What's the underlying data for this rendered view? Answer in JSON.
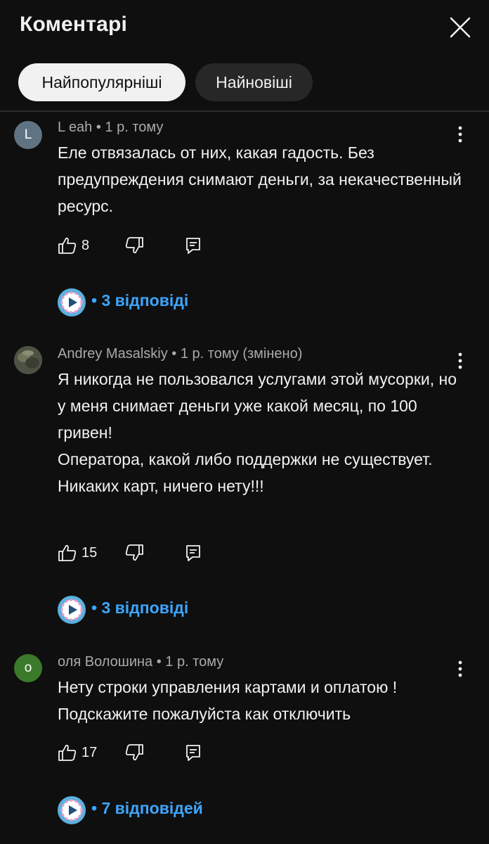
{
  "header": {
    "title": "Коментарі",
    "close_icon": "close-icon"
  },
  "sort_chips": [
    {
      "label": "Найпопулярніші",
      "selected": true
    },
    {
      "label": "Найновіші",
      "selected": false
    }
  ],
  "colors": {
    "background": "#0f0f0f",
    "accent_link": "#3ea6ff",
    "chip_active_bg": "#f1f1f1",
    "chip_inactive_bg": "#272727"
  },
  "comments": [
    {
      "avatar_letter": "L",
      "avatar_color": "#5f7382",
      "author": "L eah",
      "time": "• 1 р. тому",
      "text": "Еле отвязалась от них, какая гадость. Без предупреждения снимают деньги, за некачественный ресурс.",
      "likes": "8",
      "replies": "• 3 відповіді"
    },
    {
      "avatar_letter": "",
      "avatar_color": "#5a5f4a",
      "author": "Andrey Masalskiy",
      "time": "• 1 р. тому (змінено)",
      "text": "Я никогда не пользовался услугами этой мусорки, но у меня снимает деньги уже какой месяц, по 100 гривен!\nОператора, какой либо поддержки не существует.\nНикаких карт, ничего нету!!!",
      "likes": "15",
      "replies": "• 3 відповіді"
    },
    {
      "avatar_letter": "о",
      "avatar_color": "#3a7a2a",
      "author": "оля Волошина",
      "time": "• 1 р. тому",
      "text": "Нету строки управления картами и оплатою !\nПодскажите пожалуйста как отключить",
      "likes": "17",
      "replies": "• 7 відповідей"
    }
  ]
}
